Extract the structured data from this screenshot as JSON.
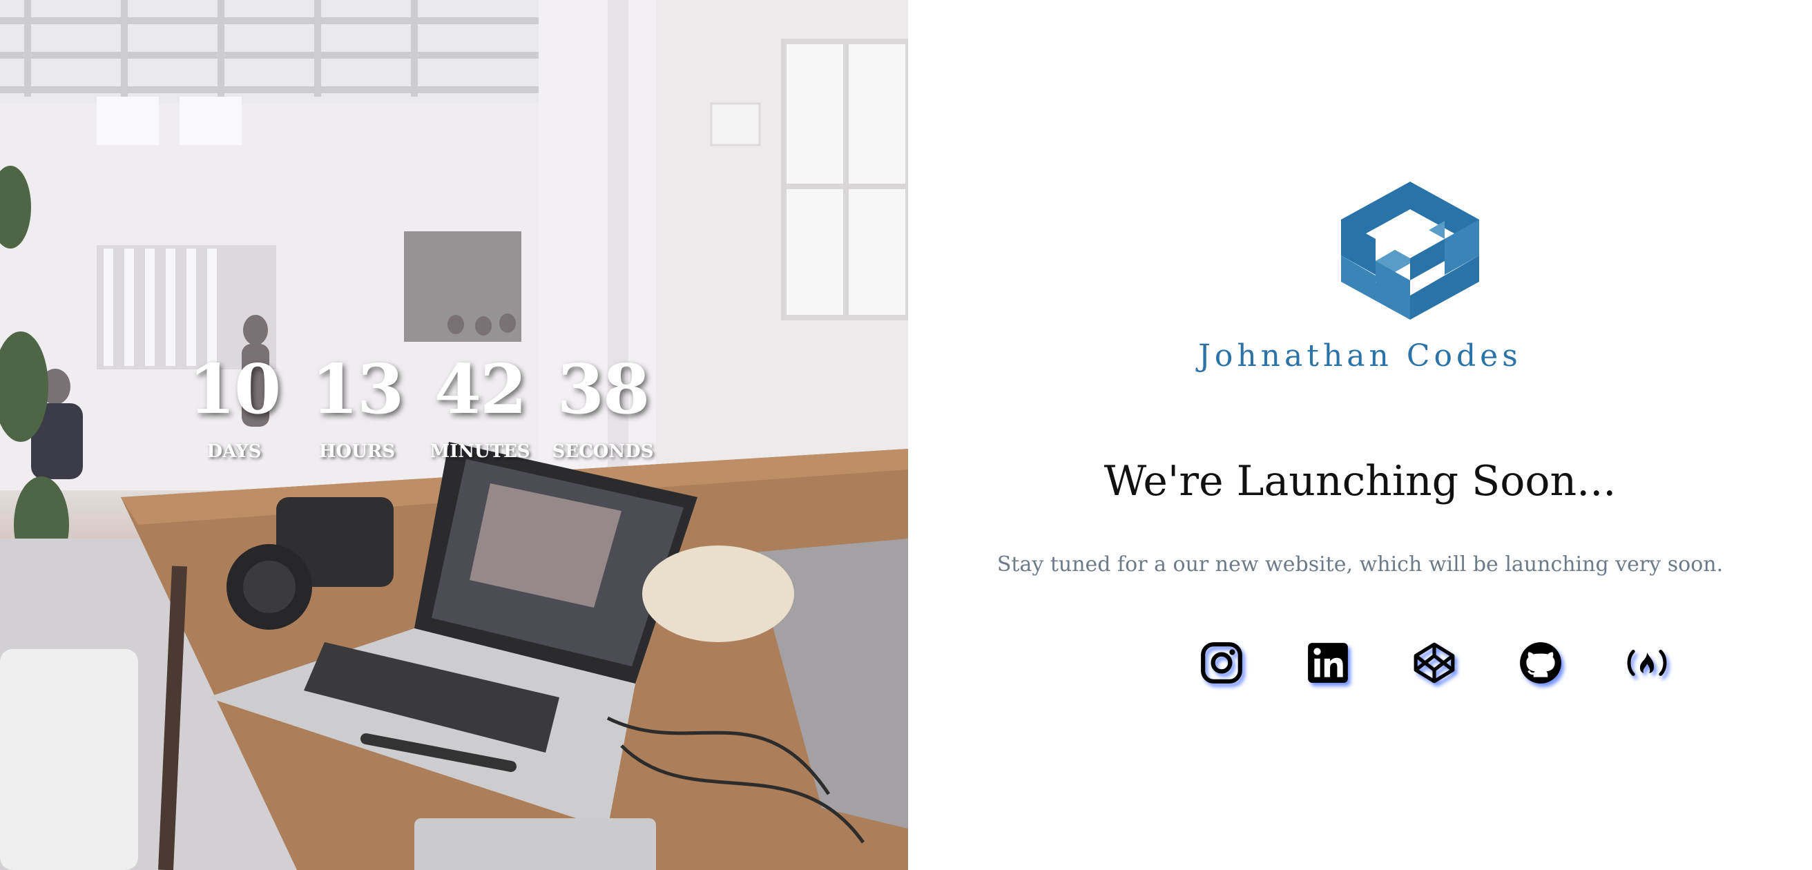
{
  "countdown": {
    "days": {
      "value": "10",
      "label": "DAYS"
    },
    "hours": {
      "value": "13",
      "label": "HOURS"
    },
    "minutes": {
      "value": "42",
      "label": "MINUTES"
    },
    "seconds": {
      "value": "38",
      "label": "SECONDS"
    }
  },
  "brand": {
    "name": "Johnathan Codes",
    "color": "#2a73a8"
  },
  "headline": "We're Launching Soon...",
  "tagline": "Stay tuned for a our new website, which will be launching very soon.",
  "socials": [
    {
      "icon": "instagram-icon"
    },
    {
      "icon": "linkedin-icon"
    },
    {
      "icon": "codepen-icon"
    },
    {
      "icon": "github-icon"
    },
    {
      "icon": "freecodecamp-icon"
    }
  ],
  "colors": {
    "headline": "#111111",
    "tagline": "#6c7a89",
    "icon_shadow": "#466eff"
  }
}
